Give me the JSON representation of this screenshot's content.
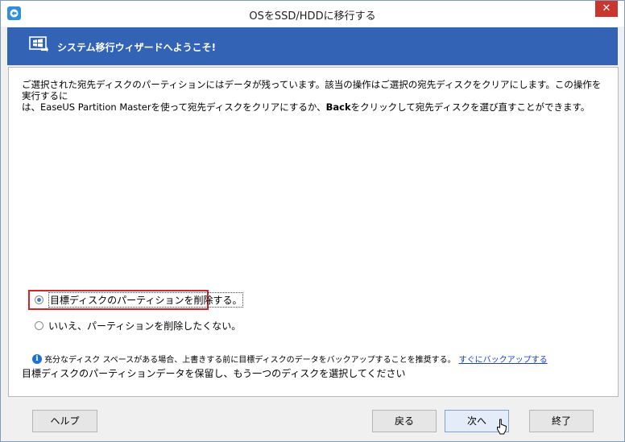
{
  "window": {
    "title": "OSをSSD/HDDに移行する",
    "close_glyph": "✕"
  },
  "banner": {
    "title": "システム移行ウィザードへようこそ!",
    "icon": "windows-migrate-icon"
  },
  "message": {
    "line1": "ご選択された宛先ディスクのパーティションにはデータが残っています。該当の操作はご選択の宛先ディスクをクリアにします。この操作を実行するに",
    "line2_pre": "は、EaseUS Partition Masterを使って宛先ディスクをクリアにするか、",
    "line2_bold": "Back",
    "line2_post": "をクリックして宛先ディスクを選び直すことができます。"
  },
  "options": {
    "delete_label": "目標ディスクのパーティションを削除する。",
    "keep_label": "いいえ、パーティションを削除したくない。",
    "selected": "delete"
  },
  "info": {
    "icon": "info-icon",
    "icon_glyph": "i",
    "text": "充分なディスク スペースがある場合、上書きする前に目標ディスクのデータをバックアップすることを推奨する。",
    "link": "すぐにバックアップする"
  },
  "keep_disk_text": "目標ディスクのパーティションデータを保留し、もう一つのディスクを選択してください",
  "buttons": {
    "help": "ヘルプ",
    "back": "戻る",
    "next": "次へ",
    "finish": "終了"
  },
  "colors": {
    "banner": "#3263b5",
    "highlight_border": "#d3232b",
    "link": "#1a40c9",
    "close": "#c7372f"
  }
}
